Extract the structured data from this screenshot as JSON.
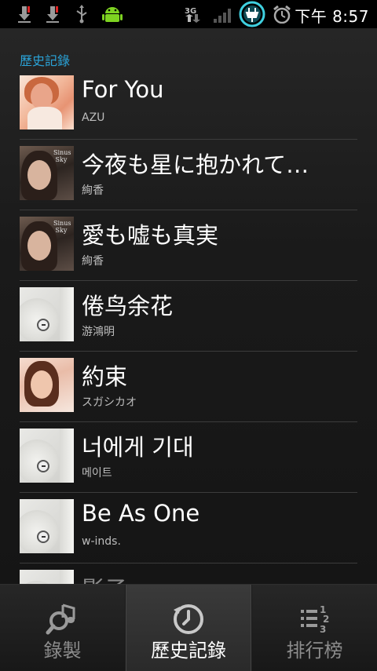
{
  "status_bar": {
    "time": "下午 8:57",
    "network": "3G",
    "icons": [
      "download-icon",
      "download-icon",
      "usb-icon",
      "android-debug-icon",
      "signal-3g-icon",
      "signal-strength-icon",
      "charging-icon",
      "alarm-icon"
    ]
  },
  "history": {
    "header": "歷史記錄",
    "items": [
      {
        "title": "For You",
        "artist": "AZU",
        "art": "azu"
      },
      {
        "title": "今夜も星に抱かれて…",
        "artist": "絢香",
        "art": "ayaka"
      },
      {
        "title": "愛も嘘も真実",
        "artist": "絢香",
        "art": "ayaka"
      },
      {
        "title": "倦鸟余花",
        "artist": "游鴻明",
        "art": "cd"
      },
      {
        "title": "約束",
        "artist": "スガシカオ",
        "art": "suga"
      },
      {
        "title": "너에게 기대",
        "artist": "메이트",
        "art": "cd"
      },
      {
        "title": "Be As One",
        "artist": "w-inds.",
        "art": "cd"
      },
      {
        "title": "影子",
        "artist": "",
        "art": "cd"
      }
    ]
  },
  "tabs": [
    {
      "label": "錄製",
      "icon": "record-search-icon",
      "active": false
    },
    {
      "label": "歷史記錄",
      "icon": "history-clock-icon",
      "active": true
    },
    {
      "label": "排行榜",
      "icon": "ranking-list-icon",
      "active": false
    }
  ],
  "colors": {
    "accent": "#2aa3d8",
    "background": "#141414",
    "status_bar": "#000000"
  }
}
